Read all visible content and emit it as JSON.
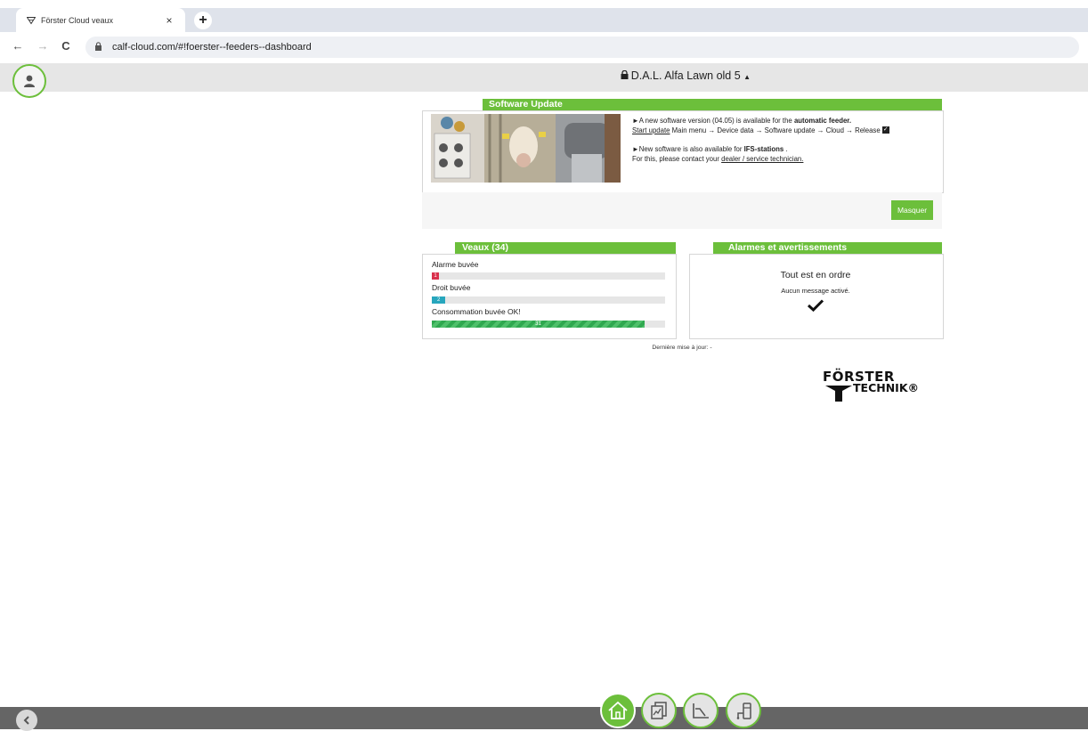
{
  "browser": {
    "tab_title": "Förster Cloud veaux",
    "tab_close": "×",
    "new_tab": "+",
    "back": "←",
    "forward": "→",
    "reload": "C",
    "url": "calf-cloud.com/#!foerster--feeders--dashboard"
  },
  "header": {
    "device_name": "D.A.L. Alfa Lawn old 5",
    "device_caret": "▲"
  },
  "software_update": {
    "title": "Software Update",
    "line1_prefix": "►A new software version (04.05) is available for the ",
    "line1_bold": "automatic feeder.",
    "line2_link": "Start update",
    "line2_rest": " Main menu → Device data → Software update → Cloud → Release ",
    "line3_prefix": "►New software is also available for ",
    "line3_bold": "IFS-stations",
    "line3_suffix": " .",
    "line4_prefix": "For this, please contact your ",
    "line4_link": "dealer / service technician.",
    "hide_button": "Masquer"
  },
  "calves": {
    "title": "Veaux (34)",
    "rows": [
      {
        "label": "Alarme buvée",
        "count": "1",
        "fraction": 0.029,
        "color": "#d9304c"
      },
      {
        "label": "Droit buvée",
        "count": "2",
        "fraction": 0.059,
        "color": "#27a6bd"
      },
      {
        "label": "Consommation buvée OK!",
        "count": "31",
        "fraction": 0.912,
        "color": "#2fa84f"
      }
    ]
  },
  "alarms": {
    "title": "Alarmes et avertissements",
    "status": "Tout est en ordre",
    "message": "Aucun message activé."
  },
  "last_update": "Dernière mise à jour: -",
  "logo": {
    "line1": "FÖRSTER",
    "line2": "TECHNIK®"
  },
  "bottom_nav": {
    "items": [
      "home-icon",
      "reports-icon",
      "chart-icon",
      "feeder-icon"
    ],
    "active": "home-icon"
  },
  "colors": {
    "accent": "#6cbf3b",
    "alarm": "#d9304c",
    "drinking": "#27a6bd",
    "ok": "#2fa84f"
  }
}
